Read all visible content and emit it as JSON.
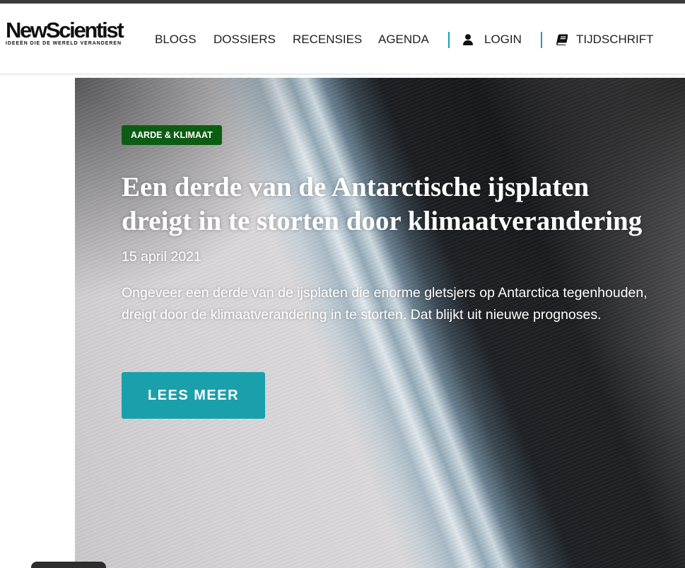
{
  "colors": {
    "top_bar": "#3a3a3a",
    "accent": "#1aa0ab",
    "category_badge": "#0b5d13",
    "nav_text": "#1e1e1e"
  },
  "header": {
    "logo": {
      "wordmark": "NewScientist",
      "tagline": "IDEEËN DIE DE WERELD VERANDEREN"
    },
    "nav": [
      {
        "label": "BLOGS"
      },
      {
        "label": "DOSSIERS"
      },
      {
        "label": "RECENSIES"
      },
      {
        "label": "AGENDA"
      }
    ],
    "login": {
      "label": "LOGIN",
      "icon": "user-icon"
    },
    "magazine": {
      "label": "TIJDSCHRIFT",
      "icon": "book-icon"
    }
  },
  "hero": {
    "category": "AARDE & KLIMAAT",
    "title": "Een derde van de Antarctische ijsplaten dreigt in te storten door klimaatverandering",
    "date": "15 april 2021",
    "summary": "Ongeveer een derde van de ijsplaten die enorme gletsjers op Antarctica tegenhouden, dreigt door de klimaatverandering in te storten. Dat blijkt uit nieuwe prognoses.",
    "cta_label": "LEES MEER"
  }
}
